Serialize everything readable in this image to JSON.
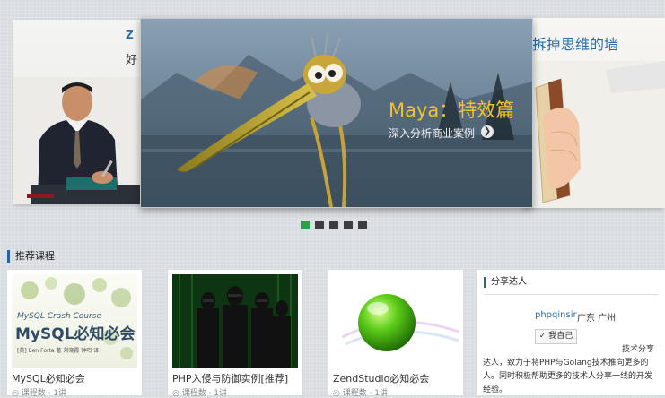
{
  "carousel": {
    "left_slide": {
      "frag_top": "Z",
      "frag_text": "好"
    },
    "main_slide": {
      "title": "Maya：特效篇",
      "subtitle": "深入分析商业案例",
      "go_icon": "arrow-right-icon"
    },
    "right_slide": {
      "title": "拆掉思维的墙"
    },
    "dots": [
      {
        "active": true
      },
      {
        "active": false
      },
      {
        "active": false
      },
      {
        "active": false
      },
      {
        "active": false
      }
    ]
  },
  "section": {
    "title": "推荐课程"
  },
  "courses": [
    {
      "name": "MySQL必知必会",
      "meta": "◎  课程数 ·  1讲",
      "thumb": {
        "en": "MySQL Crash Course",
        "zh": "MySQL必知必会",
        "authors": "[英] Ben Forta 著   刘晓霞 钟鸣 译"
      }
    },
    {
      "name": "PHP入侵与防御实例[推荐]",
      "meta": "◎  课程数 ·  1讲"
    },
    {
      "name": "ZendStudio必知必会",
      "meta": "◎  课程数 ·  1讲"
    }
  ],
  "share": {
    "title": "分享达人",
    "username": "phpqinsir",
    "location": "广东 广州",
    "me_button": "✓ 我自己",
    "bio": "技术分享达人，致力于将PHP与Golang技术推向更多的人。同时积极帮助更多的技术人分享一线的开发经验。"
  },
  "colors": {
    "accent": "#2a5ea8",
    "active_dot": "#27a04a",
    "maya_title": "#f2c12e"
  }
}
